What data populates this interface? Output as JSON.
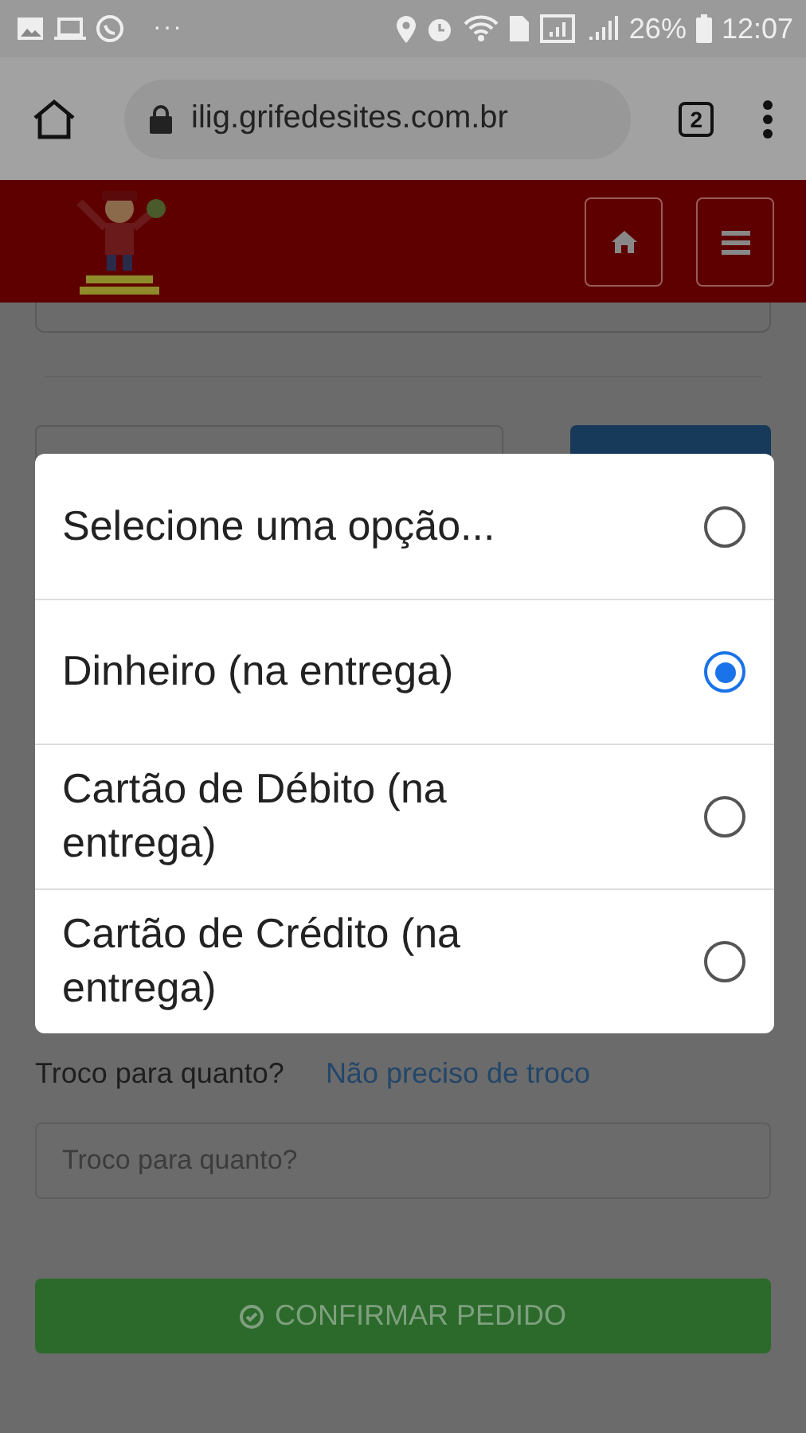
{
  "status_bar": {
    "more": "···",
    "battery": "26%",
    "time": "12:07"
  },
  "browser": {
    "url": "ilig.grifedesites.com.br",
    "tab_count": "2"
  },
  "payment_dialog": {
    "options": [
      {
        "label": "Selecione uma opção...",
        "selected": false
      },
      {
        "label": "Dinheiro (na entrega)",
        "selected": true
      },
      {
        "label": "Cartão de Débito (na entrega)",
        "selected": false
      },
      {
        "label": "Cartão de Crédito (na entrega)",
        "selected": false
      }
    ]
  },
  "change": {
    "label": "Troco para quanto?",
    "link": "Não preciso de troco",
    "field": {
      "placeholder": "Troco para quanto?"
    }
  },
  "confirm_button": {
    "label": "CONFIRMAR PEDIDO"
  }
}
